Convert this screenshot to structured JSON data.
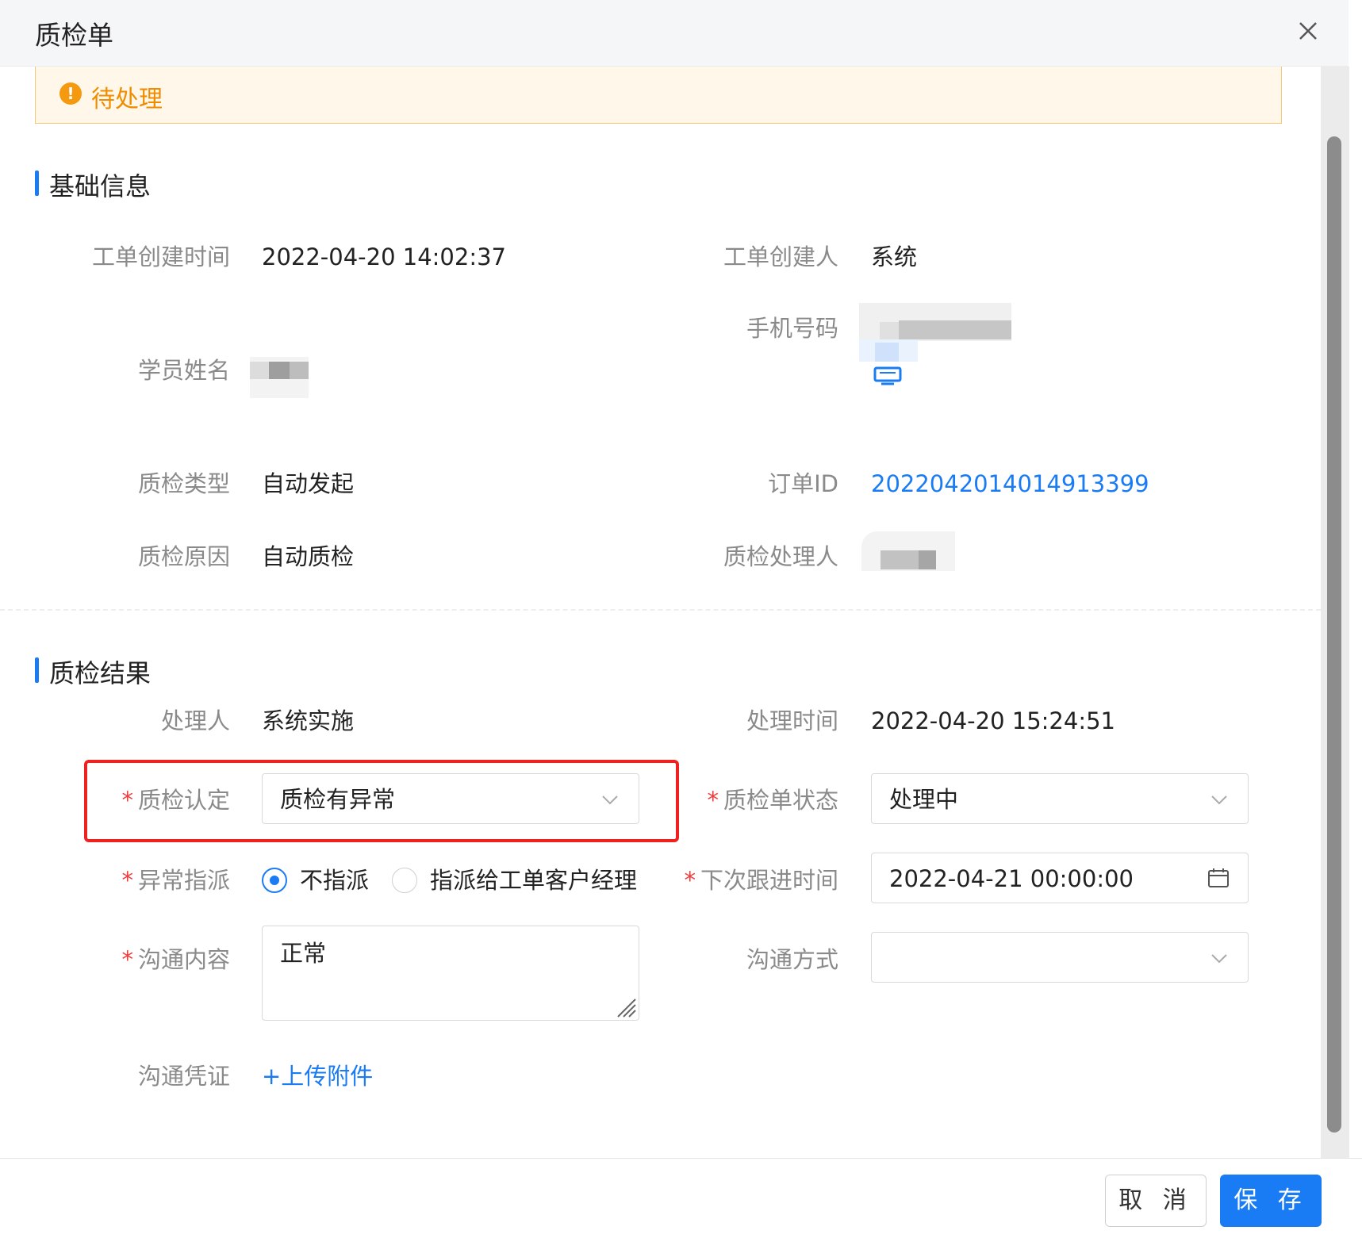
{
  "dialog": {
    "title": "质检单",
    "close_icon": "close-icon"
  },
  "alert": {
    "status": "待处理",
    "icon": "warning-icon",
    "color": "#f08c00"
  },
  "basic_info": {
    "title": "基础信息",
    "created_time_label": "工单创建时间",
    "created_time": "2022-04-20 14:02:37",
    "creator_label": "工单创建人",
    "creator": "系统",
    "phone_label": "手机号码",
    "student_name_label": "学员姓名",
    "qc_type_label": "质检类型",
    "qc_type": "自动发起",
    "order_id_label": "订单ID",
    "order_id": "2022042014014913399",
    "qc_reason_label": "质检原因",
    "qc_reason": "自动质检",
    "qc_handler_label": "质检处理人"
  },
  "result": {
    "title": "质检结果",
    "handler_label": "处理人",
    "handler": "系统实施",
    "handle_time_label": "处理时间",
    "handle_time": "2022-04-20 15:24:51",
    "qc_judgement_label": "质检认定",
    "qc_judgement": "质检有异常",
    "qc_status_label": "质检单状态",
    "qc_status": "处理中",
    "exception_assign_label": "异常指派",
    "assign_options": [
      "不指派",
      "指派给工单客户经理"
    ],
    "assign_selected": "不指派",
    "next_followup_label": "下次跟进时间",
    "next_followup": "2022-04-21 00:00:00",
    "communication_label": "沟通内容",
    "communication": "正常",
    "comm_method_label": "沟通方式",
    "comm_method": "",
    "evidence_label": "沟通凭证",
    "upload_label": "+上传附件"
  },
  "footer": {
    "cancel": "取 消",
    "save": "保 存"
  },
  "colors": {
    "primary": "#1a7cf5",
    "required": "#f23c3c",
    "highlight": "#ef2020",
    "alert_bg": "#fff8ea"
  }
}
